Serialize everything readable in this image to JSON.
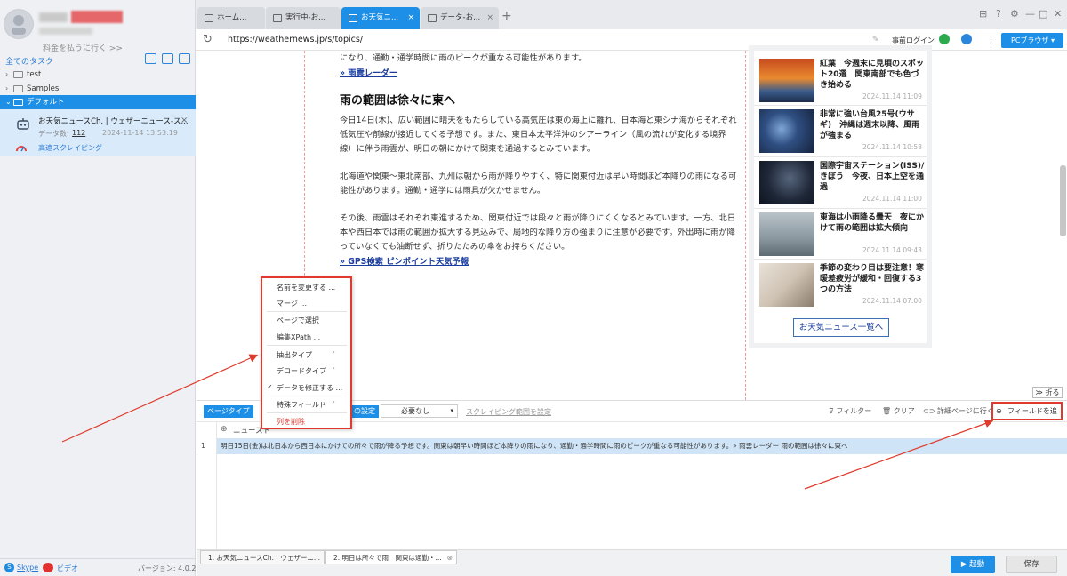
{
  "sidebar": {
    "pay_link": "料金を払うに行く >>",
    "all_tasks": "全てのタスク",
    "tree": [
      {
        "label": "test",
        "expanded": false
      },
      {
        "label": "Samples",
        "expanded": false
      },
      {
        "label": "デフォルト",
        "expanded": true
      }
    ],
    "task": {
      "title": "お天気ニュースCh. | ウェザーニュース-ス...",
      "count_label": "データ数:",
      "count": "112",
      "date": "2024-11-14 13:53:19",
      "fast_scrape": "高速スクレイピング"
    },
    "skype": "Skype",
    "video": "ビデオ",
    "version": "バージョン: 4.0.2"
  },
  "tabs": [
    {
      "label": "ホーム..."
    },
    {
      "label": "実行中-お..."
    },
    {
      "label": "お天気ニ...",
      "active": true
    },
    {
      "label": "データ-お..."
    }
  ],
  "address": {
    "url": "https://weathernews.jp/s/topics/",
    "prelogin": "事前ログイン",
    "browser_button": "PCブラウザ"
  },
  "article": {
    "top_text": "になり、通勤・通学時間に雨のピークが重なる可能性があります。",
    "link1": "» 雨雲レーダー",
    "heading": "雨の範囲は徐々に東へ",
    "para1": "今日14日(木)、広い範囲に晴天をもたらしている高気圧は東の海上に離れ、日本海と東シナ海からそれぞれ低気圧や前線が接近してくる予想です。また、東日本太平洋沖のシアーライン（風の流れが変化する境界線）に伴う雨雲が、明日の朝にかけて関東を通過するとみています。",
    "para2": "北海道や関東～東北南部、九州は朝から雨が降りやすく、特に関東付近は早い時間ほど本降りの雨になる可能性があります。通勤・通学には雨具が欠かせません。",
    "para3": "その後、雨雲はそれぞれ東進するため、関東付近では段々と雨が降りにくくなるとみています。一方、北日本や西日本では雨の範囲が拡大する見込みで、局地的な降り方の強まりに注意が必要です。外出時に雨が降っていなくても油断せず、折りたたみの傘をお持ちください。",
    "link2": "» GPS検索 ピンポイント天気予報"
  },
  "news": [
    {
      "title": "紅葉　今週末に見頃のスポット20選　関東南部でも色づき始める",
      "date": "2024.11.14 11:09"
    },
    {
      "title": "非常に強い台風25号(ウサギ)　沖縄は週末以降、風雨が強まる",
      "date": "2024.11.14 10:58"
    },
    {
      "title": "国際宇宙ステーション(ISS)/きぼう　今夜、日本上空を通過",
      "date": "2024.11.14 11:00"
    },
    {
      "title": "東海は小雨降る曇天　夜にかけて雨の範囲は拡大傾向",
      "date": "2024.11.14 09:43"
    },
    {
      "title": "季節の変わり目は要注意！寒暖差疲労が緩和・回復する3つの方法",
      "date": "2024.11.14 07:00"
    }
  ],
  "news_more": "お天気ニュース一覧へ",
  "fold": "折る",
  "toolbar": {
    "page_type": "ページタイプ",
    "settings": "の設定",
    "need": "必要なし",
    "scrape_range": "スクレイピング範囲を設定",
    "filter": "フィルター",
    "clear": "クリア",
    "detail": "詳細ページに行く",
    "add_field": "フィールドを追加"
  },
  "grid": {
    "column": "ニュースト",
    "rows": [
      {
        "num": "1",
        "text": "明日15日(金)は北日本から西日本にかけての所々で雨が降る予想です。関東は朝早い時間ほど本降りの雨になり、通勤・通学時間に雨のピークが重なる可能性があります。» 雨雲レーダー 雨の範囲は徐々に東へ"
      }
    ]
  },
  "bottom_tabs": [
    {
      "label": "1. お天気ニュースCh. | ウェザーニ..."
    },
    {
      "label": "2. 明日は所々で雨　関東は通勤・..."
    }
  ],
  "start": "起動",
  "save": "保存",
  "context_menu": {
    "items": [
      {
        "label": "名前を変更する ..."
      },
      {
        "label": "マージ ..."
      },
      {
        "label": "ページで選択"
      },
      {
        "label": "編集XPath ..."
      },
      {
        "label": "抽出タイプ",
        "submenu": true
      },
      {
        "label": "デコードタイプ",
        "submenu": true
      },
      {
        "label": "データを修正する ...",
        "checked": true
      },
      {
        "label": "特殊フィールド",
        "submenu": true
      },
      {
        "label": "列を削除",
        "danger": true
      }
    ]
  },
  "colors": {
    "accent": "#1d8fe6",
    "highlight": "#e03a2e",
    "link": "#1a3d9e"
  }
}
